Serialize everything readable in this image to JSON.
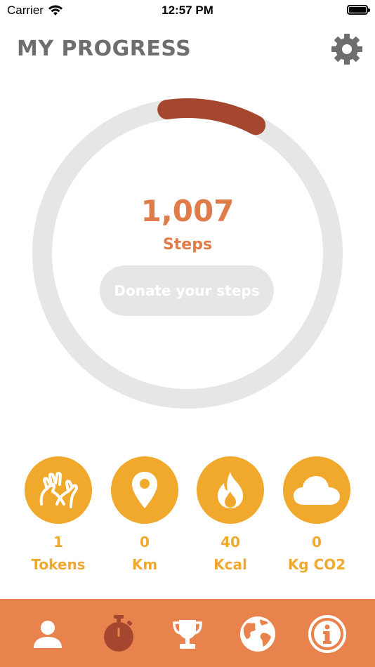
{
  "status_bar": {
    "carrier": "Carrier",
    "time": "12:57 PM"
  },
  "header": {
    "title": "MY PROGRESS",
    "settings_icon": "gear-icon"
  },
  "progress": {
    "steps_value": "1,007",
    "steps_label": "Steps",
    "ring_fraction": 0.1,
    "donate_label": "Donate your steps"
  },
  "stats": [
    {
      "icon": "hands-icon",
      "value": "1",
      "label": "Tokens"
    },
    {
      "icon": "location-pin-icon",
      "value": "0",
      "label": "Km"
    },
    {
      "icon": "flame-icon",
      "value": "40",
      "label": "Kcal"
    },
    {
      "icon": "cloud-icon",
      "value": "0",
      "label": "Kg CO2"
    }
  ],
  "tab_bar": {
    "items": [
      {
        "icon": "person-icon",
        "active": true
      },
      {
        "icon": "stopwatch-icon",
        "active": false
      },
      {
        "icon": "trophy-icon",
        "active": false
      },
      {
        "icon": "globe-icon",
        "active": false
      },
      {
        "icon": "info-icon",
        "active": false
      }
    ]
  },
  "colors": {
    "accent_orange": "#e07c4a",
    "tab_bar": "#e8834e",
    "stat_yellow": "#f0a92d",
    "ring_progress": "#a5472f",
    "ring_track": "#e6e6e6",
    "title_gray": "#6e6e6e"
  }
}
